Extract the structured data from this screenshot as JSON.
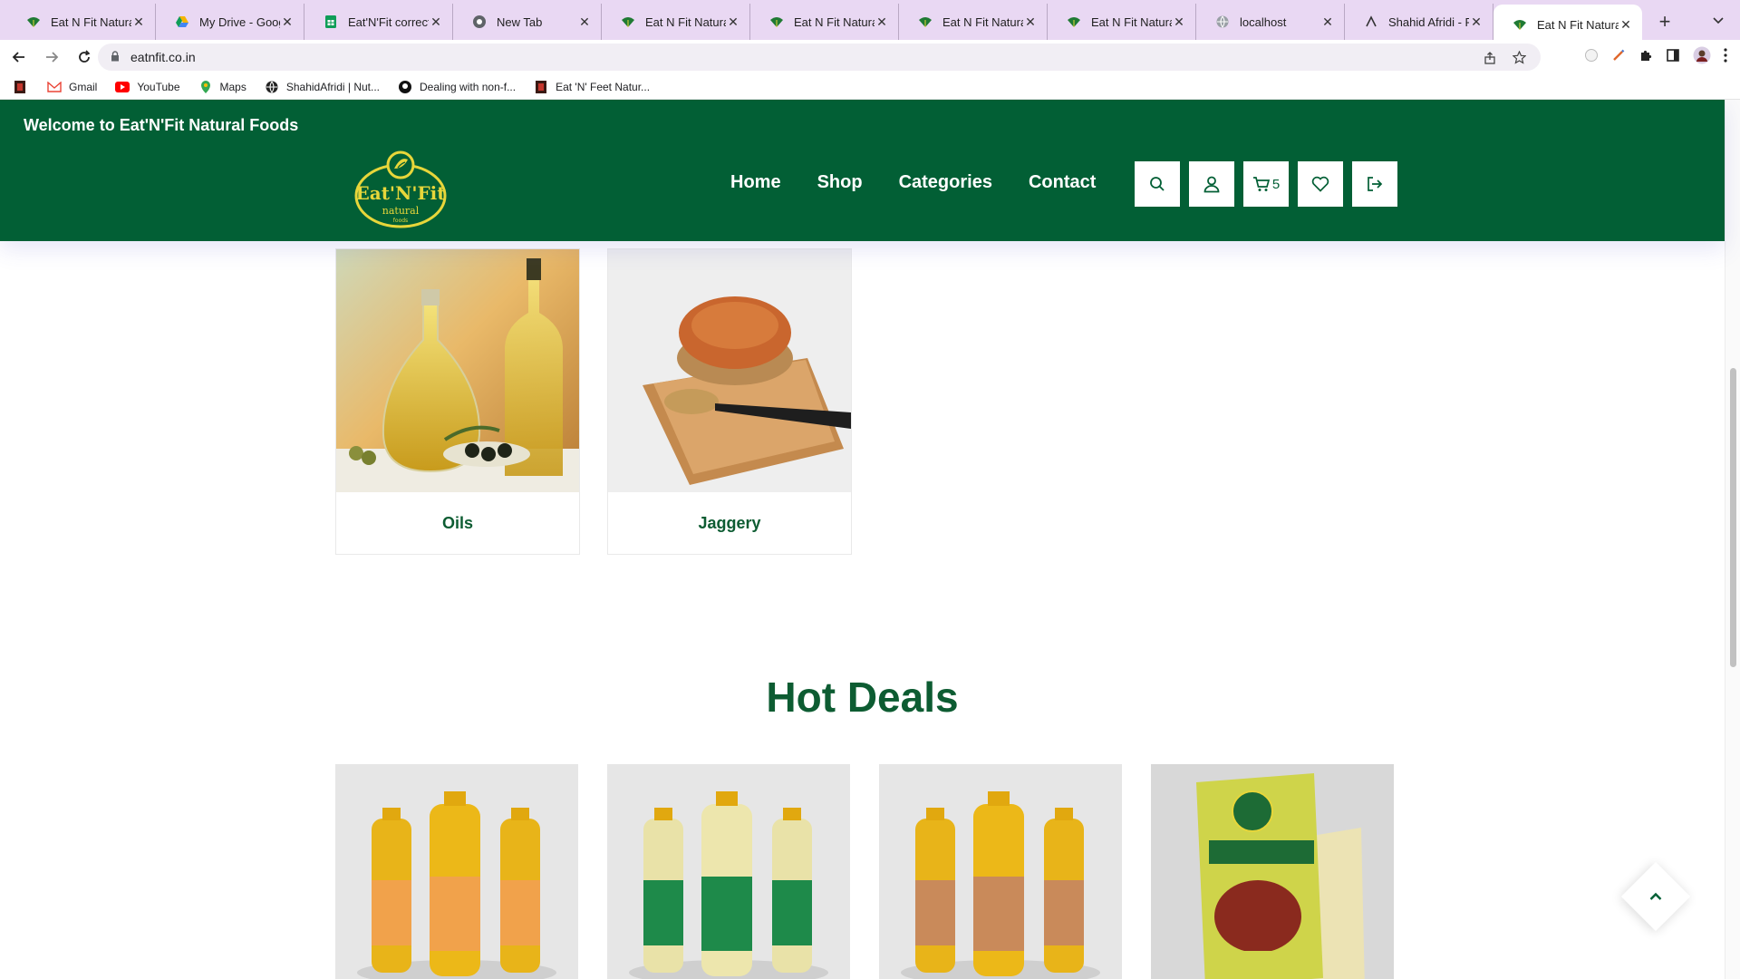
{
  "browser": {
    "tabs": [
      {
        "title": "Eat N Fit Naturals",
        "icon": "leaf-favicon-icon",
        "active": false
      },
      {
        "title": "My Drive - Google Drive",
        "icon": "google-drive-icon",
        "active": false
      },
      {
        "title": "Eat'N'Fit correction",
        "icon": "google-sheets-icon",
        "active": false
      },
      {
        "title": "New Tab",
        "icon": "chrome-icon",
        "active": false
      },
      {
        "title": "Eat N Fit Naturals",
        "icon": "leaf-favicon-icon",
        "active": false
      },
      {
        "title": "Eat N Fit Naturals",
        "icon": "leaf-favicon-icon",
        "active": false
      },
      {
        "title": "Eat N Fit Naturals",
        "icon": "leaf-favicon-icon",
        "active": false
      },
      {
        "title": "Eat N Fit Naturals",
        "icon": "leaf-favicon-icon",
        "active": false
      },
      {
        "title": "localhost",
        "icon": "globe-icon",
        "active": false
      },
      {
        "title": "Shahid Afridi - Portfolio",
        "icon": "portfolio-icon",
        "active": false
      },
      {
        "title": "Eat N Fit Naturals",
        "icon": "leaf-favicon-icon",
        "active": true
      }
    ],
    "url": "eatnfit.co.in",
    "bookmarks": [
      {
        "label": "",
        "icon": "eatnfit-bookmark-icon"
      },
      {
        "label": "Gmail",
        "icon": "gmail-icon"
      },
      {
        "label": "YouTube",
        "icon": "youtube-icon"
      },
      {
        "label": "Maps",
        "icon": "maps-icon"
      },
      {
        "label": "ShahidAfridi | Nut...",
        "icon": "globe-icon"
      },
      {
        "label": "Dealing with non-f...",
        "icon": "github-icon"
      },
      {
        "label": "Eat 'N' Feet Natur...",
        "icon": "eatnfit-bookmark-icon"
      }
    ]
  },
  "site": {
    "welcome": "Welcome to Eat'N'Fit Natural Foods",
    "logo": {
      "brand": "Eat'N'Fit",
      "sub": "natural",
      "tag": "foods"
    },
    "nav": [
      "Home",
      "Shop",
      "Categories",
      "Contact"
    ],
    "cart_count": "5",
    "categories": [
      {
        "name": "Oils"
      },
      {
        "name": "Jaggery"
      }
    ],
    "hot_deals_title": "Hot Deals",
    "deals": [
      {
        "label": "groundnut-oil-bottles",
        "tint": "#f1a24b"
      },
      {
        "label": "coconut-oil-bottles",
        "tint": "#1e8a4a"
      },
      {
        "label": "sesame-oil-bottles",
        "tint": "#c98a5a"
      },
      {
        "label": "jaggery-powder-pack",
        "tint": "#cfd44a"
      }
    ],
    "colors": {
      "brand_green": "#025f35",
      "heading_green": "#0d5c32"
    }
  }
}
